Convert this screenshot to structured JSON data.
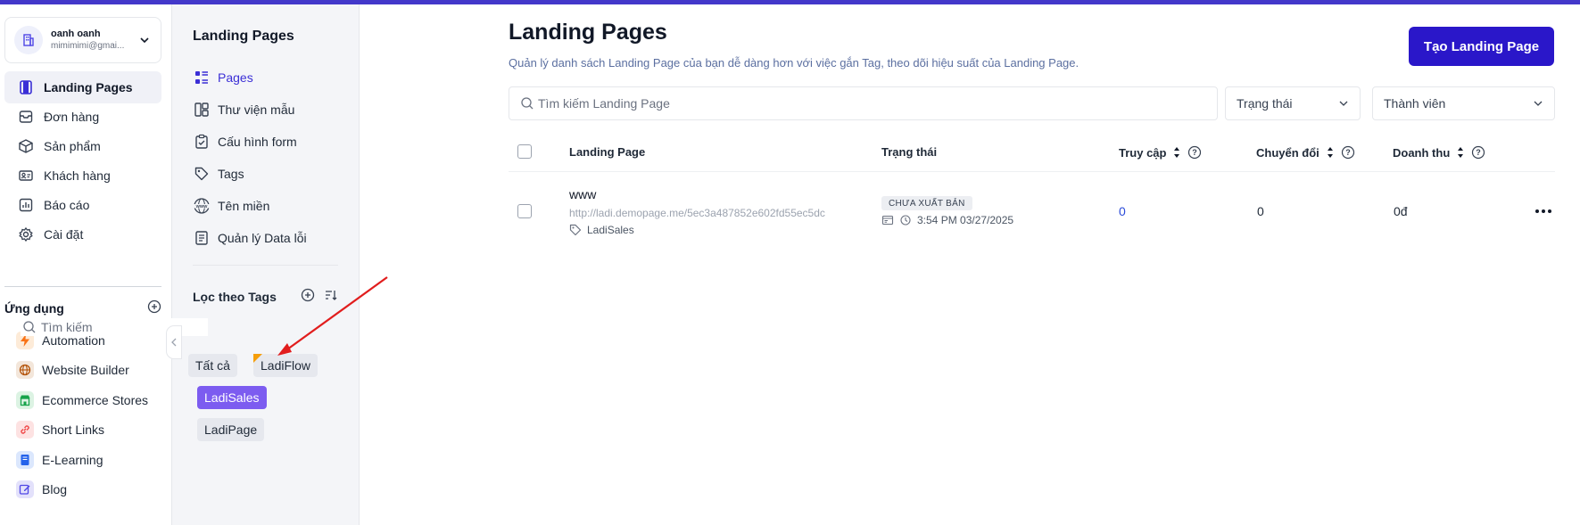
{
  "account": {
    "name": "oanh oanh",
    "email": "mimimimi@gmai..."
  },
  "nav": {
    "items": [
      {
        "label": "Landing Pages",
        "icon": "landing-pages-icon",
        "active": true
      },
      {
        "label": "Đơn hàng",
        "icon": "orders-icon"
      },
      {
        "label": "Sản phẩm",
        "icon": "box-icon"
      },
      {
        "label": "Khách hàng",
        "icon": "customer-card-icon"
      },
      {
        "label": "Báo cáo",
        "icon": "chart-icon"
      },
      {
        "label": "Cài đặt",
        "icon": "gear-icon"
      }
    ],
    "apps_heading": "Ứng dụng",
    "apps": [
      {
        "label": "Automation",
        "icon": "lightning-icon",
        "color": "#f97316"
      },
      {
        "label": "Website Builder",
        "icon": "globe-icon",
        "color": "#b45309"
      },
      {
        "label": "Ecommerce Stores",
        "icon": "store-icon",
        "color": "#16a34a"
      },
      {
        "label": "Short Links",
        "icon": "link-icon",
        "color": "#ef4444"
      },
      {
        "label": "E-Learning",
        "icon": "book-icon",
        "color": "#2563eb"
      },
      {
        "label": "Blog",
        "icon": "edit-icon",
        "color": "#4f46e5"
      }
    ]
  },
  "subpanel": {
    "title": "Landing Pages",
    "items": [
      {
        "label": "Pages",
        "icon": "pages-icon",
        "active": true
      },
      {
        "label": "Thư viện mẫu",
        "icon": "template-icon"
      },
      {
        "label": "Cấu hình form",
        "icon": "form-icon"
      },
      {
        "label": "Tags",
        "icon": "tag-icon"
      },
      {
        "label": "Tên miền",
        "icon": "www-icon"
      },
      {
        "label": "Quản lý Data lỗi",
        "icon": "document-icon"
      }
    ],
    "tags_heading": "Lọc theo Tags",
    "tag_search_placeholder": "Tìm kiếm",
    "tags": [
      {
        "label": "Tất cả"
      },
      {
        "label": "LadiFlow",
        "marked": true
      },
      {
        "label": "LadiSales",
        "selected": true
      },
      {
        "label": "LadiPage"
      }
    ]
  },
  "main": {
    "title": "Landing Pages",
    "subtitle": "Quản lý danh sách Landing Page của bạn dễ dàng hơn với việc gắn Tag, theo dõi hiệu suất của Landing Page.",
    "create_button": "Tạo Landing Page",
    "search_placeholder": "Tìm kiếm Landing Page",
    "filter_status": "Trạng thái",
    "filter_member": "Thành viên",
    "columns": {
      "landing_page": "Landing Page",
      "status": "Trạng thái",
      "visits": "Truy cập",
      "conversions": "Chuyển đổi",
      "revenue": "Doanh thu"
    },
    "rows": [
      {
        "name": "www",
        "url": "http://ladi.demopage.me/5ec3a487852e602fd55ec5dc",
        "tag": "LadiSales",
        "status": "CHƯA XUẤT BẢN",
        "time": "3:54 PM 03/27/2025",
        "visits": "0",
        "conversions": "0",
        "revenue": "0đ"
      }
    ]
  },
  "colors": {
    "accent": "#2a17c9",
    "selected_tag": "#7c5cf0",
    "annotation_arrow": "#e11d1d"
  }
}
